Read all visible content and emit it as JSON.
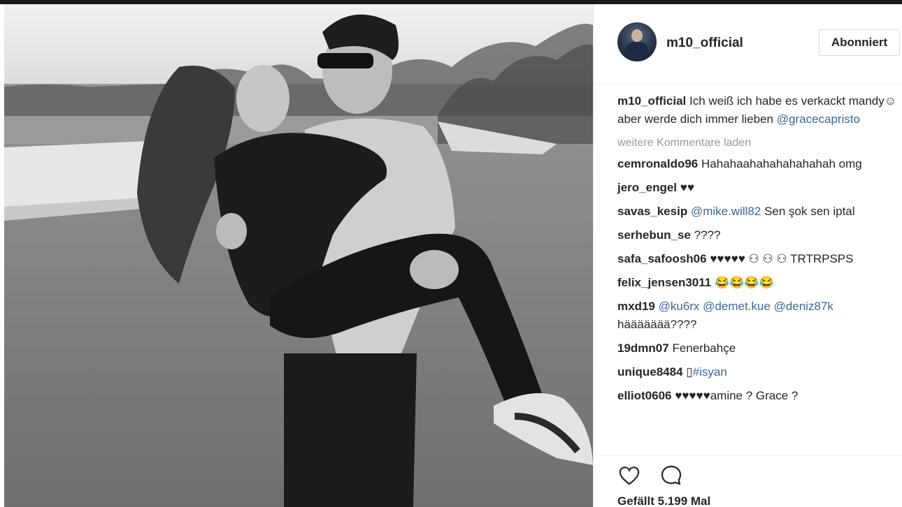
{
  "post": {
    "author": "m10_official",
    "follow_label": "Abonniert",
    "caption_user": "m10_official",
    "caption_text": "Ich weiß ich habe es verkackt mandy☺ aber werde dich immer lieben ",
    "caption_mention": "@gracecapristo",
    "load_more": "weitere Kommentare laden",
    "likes": "Gefällt 5.199 Mal"
  },
  "comments": [
    {
      "user": "cemronaldo96",
      "text": "Hahahaahahahahahahah omg",
      "mentions": []
    },
    {
      "user": "jero_engel",
      "text": "♥♥",
      "mentions": []
    },
    {
      "user": "savas_kesip",
      "mentions": [
        "@mike.will82"
      ],
      "text": "Sen şok sen iptal"
    },
    {
      "user": "serhebun_se",
      "text": "????",
      "mentions": []
    },
    {
      "user": "safa_safoosh06",
      "text": "♥♥♥♥♥ ⚇ ⚇ ⚇ TRTRPSPS",
      "mentions": []
    },
    {
      "user": "felix_jensen3011",
      "text": "😂😂😂😂",
      "mentions": []
    },
    {
      "user": "mxd19",
      "mentions": [
        "@ku6rx",
        "@demet.kue",
        "@deniz87k"
      ],
      "text": "häääääää????"
    },
    {
      "user": "19dmn07",
      "text": "Fenerbahçe",
      "mentions": []
    },
    {
      "user": "unique8484",
      "text": "▯",
      "mentions": [
        "#isyan"
      ]
    },
    {
      "user": "elliot0606",
      "text": "♥♥♥♥♥amine ? Grace ?",
      "mentions": []
    }
  ],
  "icons": {
    "like": "heart-icon",
    "comment": "comment-icon"
  },
  "colors": {
    "mention": "#3e6598",
    "muted": "#999999",
    "text": "#262626"
  }
}
